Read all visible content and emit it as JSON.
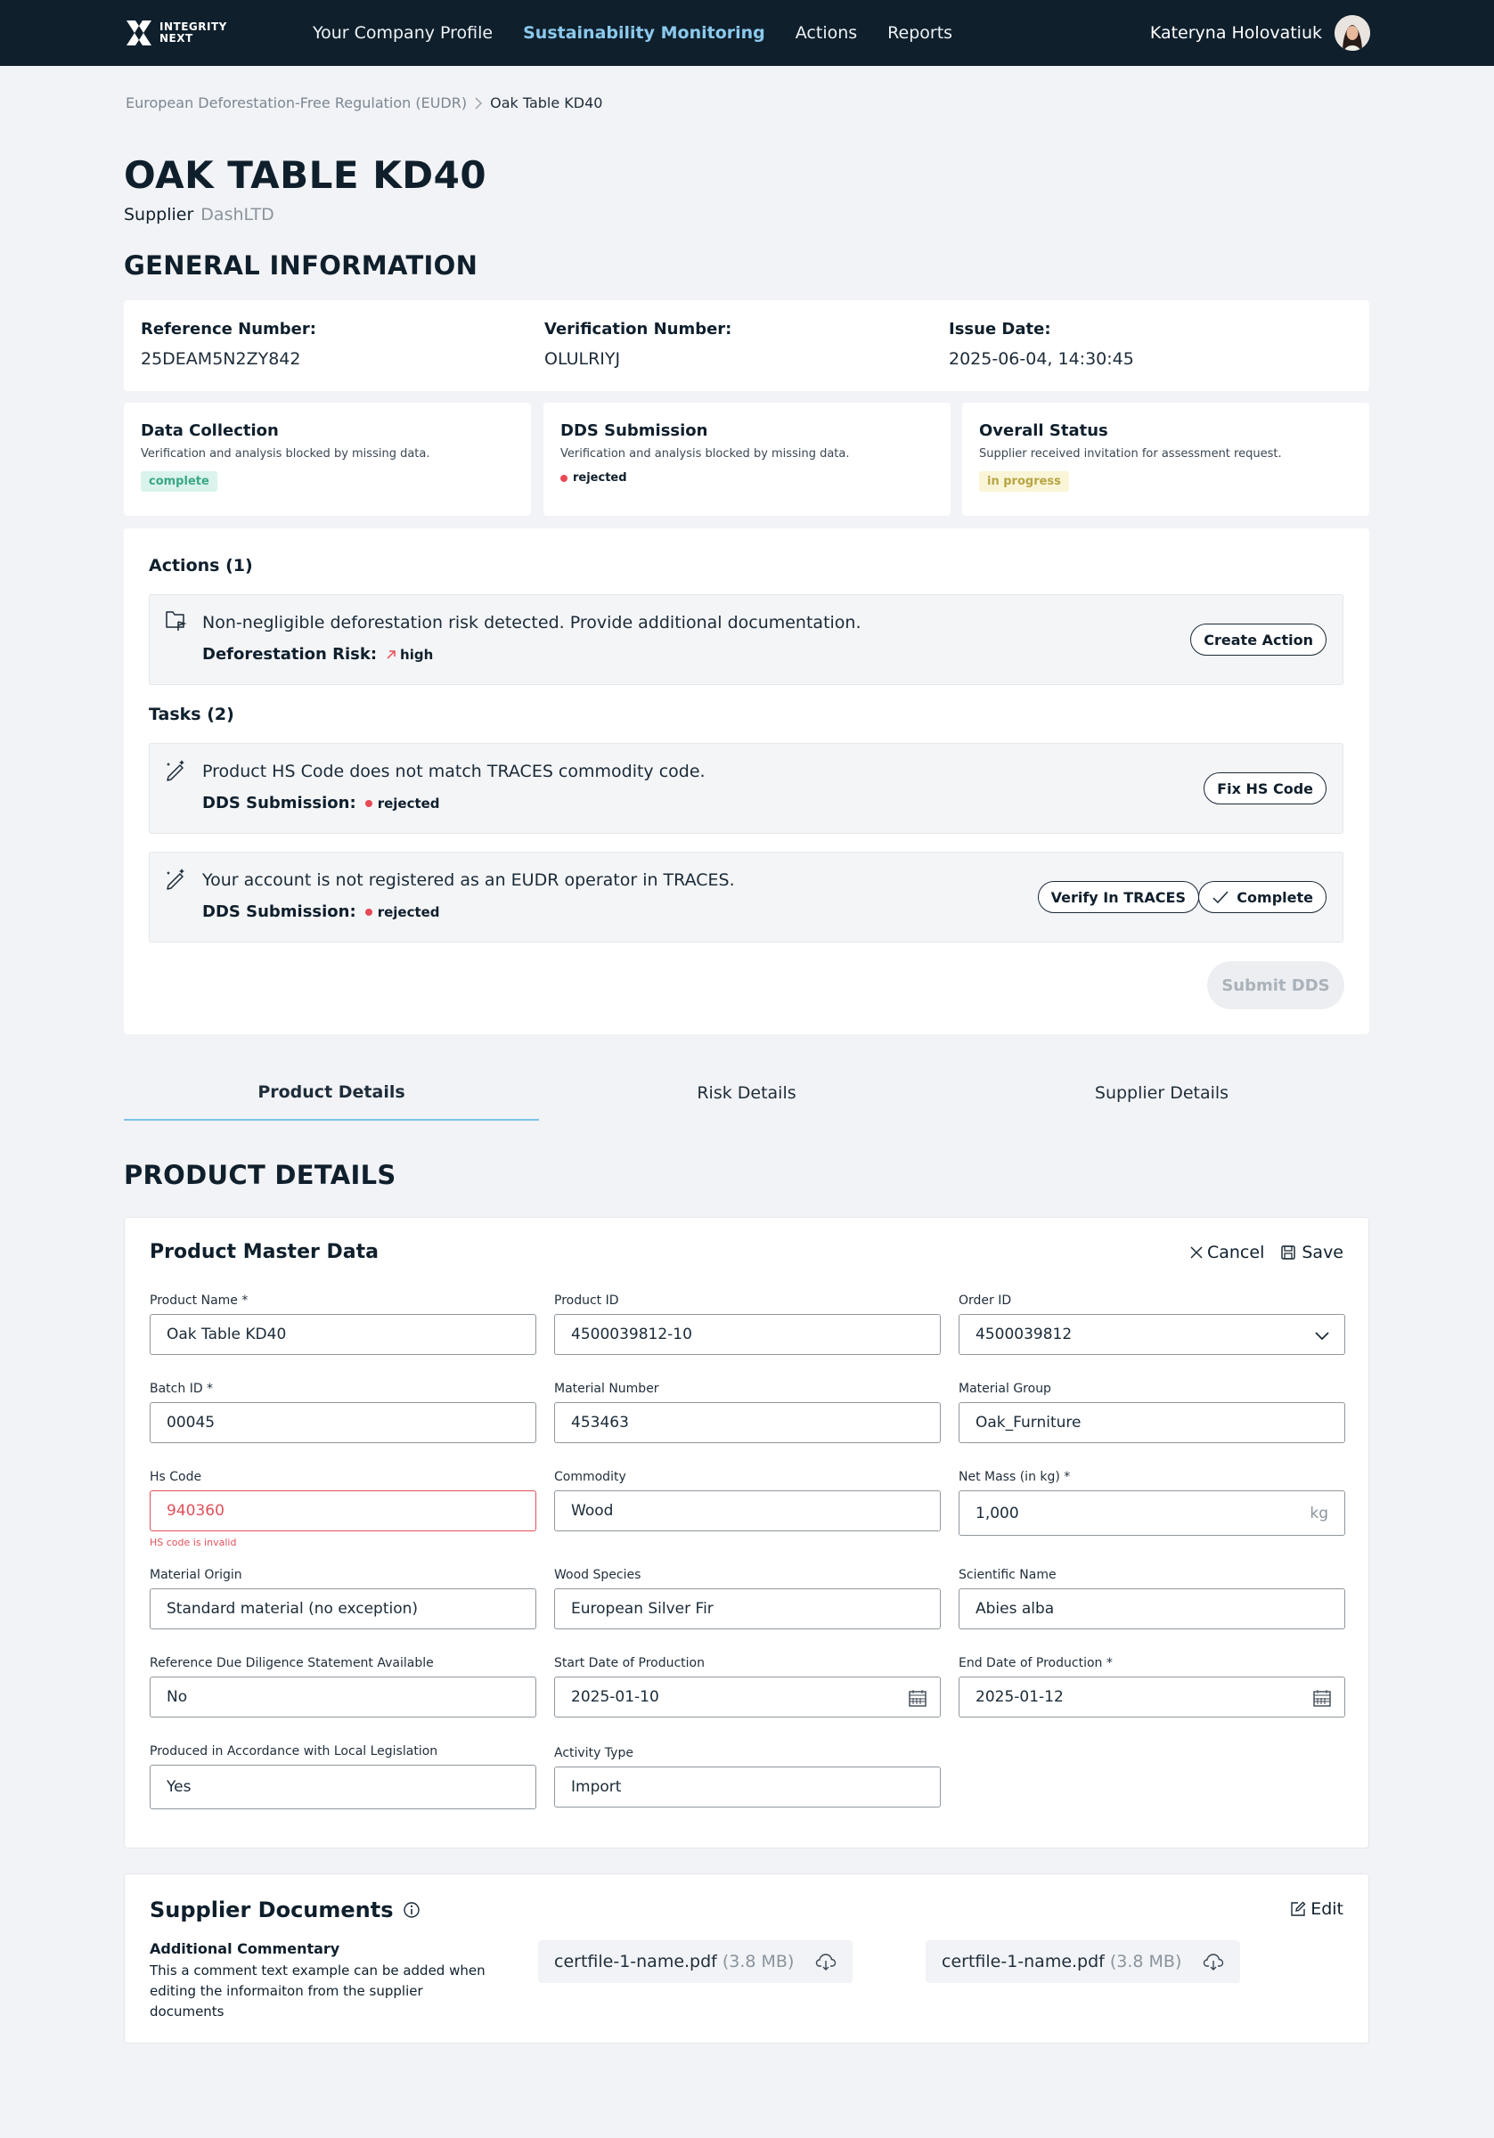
{
  "brand": {
    "line1": "INTEGRITY",
    "line2": "NEXT"
  },
  "nav": {
    "items": [
      "Your Company Profile",
      "Sustainability Monitoring",
      "Actions",
      "Reports"
    ],
    "active": "Sustainability Monitoring"
  },
  "user": {
    "name": "Kateryna Holovatiuk"
  },
  "breadcrumb": {
    "parent": "European Deforestation-Free Regulation (EUDR)",
    "current": "Oak Table KD40"
  },
  "page": {
    "title": "OAK TABLE KD40",
    "supplier_label": "Supplier",
    "supplier_value": "DashLTD"
  },
  "general": {
    "title": "GENERAL INFORMATION",
    "reference_label": "Reference Number:",
    "reference_value": "25DEAM5N2ZY842",
    "verification_label": "Verification Number:",
    "verification_value": "OLULRIYJ",
    "issue_label": "Issue Date:",
    "issue_value": "2025-06-04, 14:30:45"
  },
  "statuses": {
    "data_collection": {
      "title": "Data Collection",
      "desc": "Verification and analysis blocked by missing data.",
      "badge": "complete"
    },
    "dds_submission": {
      "title": "DDS Submission",
      "desc": "Verification and analysis blocked by missing data.",
      "badge": "rejected"
    },
    "overall": {
      "title": "Overall Status",
      "desc": "Supplier received invitation for assessment request.",
      "badge": "in progress"
    }
  },
  "actions": {
    "heading": "Actions (1)",
    "items": [
      {
        "text": "Non-negligible deforestation risk detected. Provide additional documentation.",
        "meta_label": "Deforestation Risk:",
        "meta_value": "high",
        "button": "Create Action"
      }
    ]
  },
  "tasks": {
    "heading": "Tasks (2)",
    "items": [
      {
        "text": "Product HS Code does not match TRACES commodity code.",
        "meta_label": "DDS Submission:",
        "meta_value": "rejected",
        "button": "Fix HS Code"
      },
      {
        "text": "Your account is not registered as an EUDR operator in TRACES.",
        "meta_label": "DDS Submission:",
        "meta_value": "rejected",
        "button": "Verify In TRACES",
        "button2": "Complete"
      }
    ]
  },
  "submit_button": "Submit DDS",
  "tabs": [
    "Product Details",
    "Risk Details",
    "Supplier Details"
  ],
  "product": {
    "title": "PRODUCT DETAILS",
    "card_title": "Product Master Data",
    "cancel": "Cancel",
    "save": "Save",
    "fields": {
      "product_name": {
        "label": "Product Name *",
        "value": "Oak Table KD40"
      },
      "product_id": {
        "label": "Product ID",
        "value": "4500039812-10"
      },
      "order_id": {
        "label": "Order ID",
        "value": "4500039812"
      },
      "batch_id": {
        "label": "Batch ID *",
        "value": "00045"
      },
      "material_number": {
        "label": "Material Number",
        "value": "453463"
      },
      "material_group": {
        "label": "Material Group",
        "value": "Oak_Furniture"
      },
      "hs_code": {
        "label": "Hs Code",
        "value": "940360",
        "error": "HS code is invalid"
      },
      "commodity": {
        "label": "Commodity",
        "value": "Wood"
      },
      "net_mass": {
        "label": "Net Mass (in kg) *",
        "value": "1,000",
        "unit": "kg"
      },
      "material_origin": {
        "label": "Material Origin",
        "value": "Standard material (no exception)"
      },
      "wood_species": {
        "label": "Wood Species",
        "value": "European Silver Fir"
      },
      "scientific_name": {
        "label": "Scientific Name",
        "value": "Abies alba"
      },
      "ref_dds": {
        "label": "Reference Due Diligence Statement Available",
        "value": "No"
      },
      "start_date": {
        "label": "Start Date of Production",
        "value": "2025-01-10"
      },
      "end_date": {
        "label": "End Date of Production *",
        "value": "2025-01-12"
      },
      "local_legislation": {
        "label": "Produced in Accordance with Local Legislation",
        "value": "Yes"
      },
      "activity_type": {
        "label": "Activity Type",
        "value": "Import"
      }
    }
  },
  "documents": {
    "title": "Supplier Documents",
    "edit": "Edit",
    "commentary_label": "Additional Commentary",
    "commentary_text": "This a comment text example can be added when editing the informaiton from the supplier documents",
    "files": [
      {
        "name": "certfile-1-name.pdf",
        "size": "(3.8 MB)"
      },
      {
        "name": "certfile-1-name.pdf",
        "size": "(3.8 MB)"
      }
    ]
  },
  "colors": {
    "topbar": "#0f1f2c",
    "nav_active": "#8bc9ec",
    "complete_badge": "#3aa786",
    "progress_badge": "#b7a543",
    "rejected_dot": "#e84a55",
    "risk_high": "#e84a55",
    "error": "#e0505a"
  },
  "icons": [
    "logo-x-icon",
    "chevron-right-icon",
    "document-flag-icon",
    "arrow-up-right-icon",
    "magic-pen-icon",
    "check-icon",
    "close-icon",
    "save-icon",
    "chevron-down-icon",
    "calendar-icon",
    "info-icon",
    "edit-icon",
    "cloud-download-icon"
  ]
}
